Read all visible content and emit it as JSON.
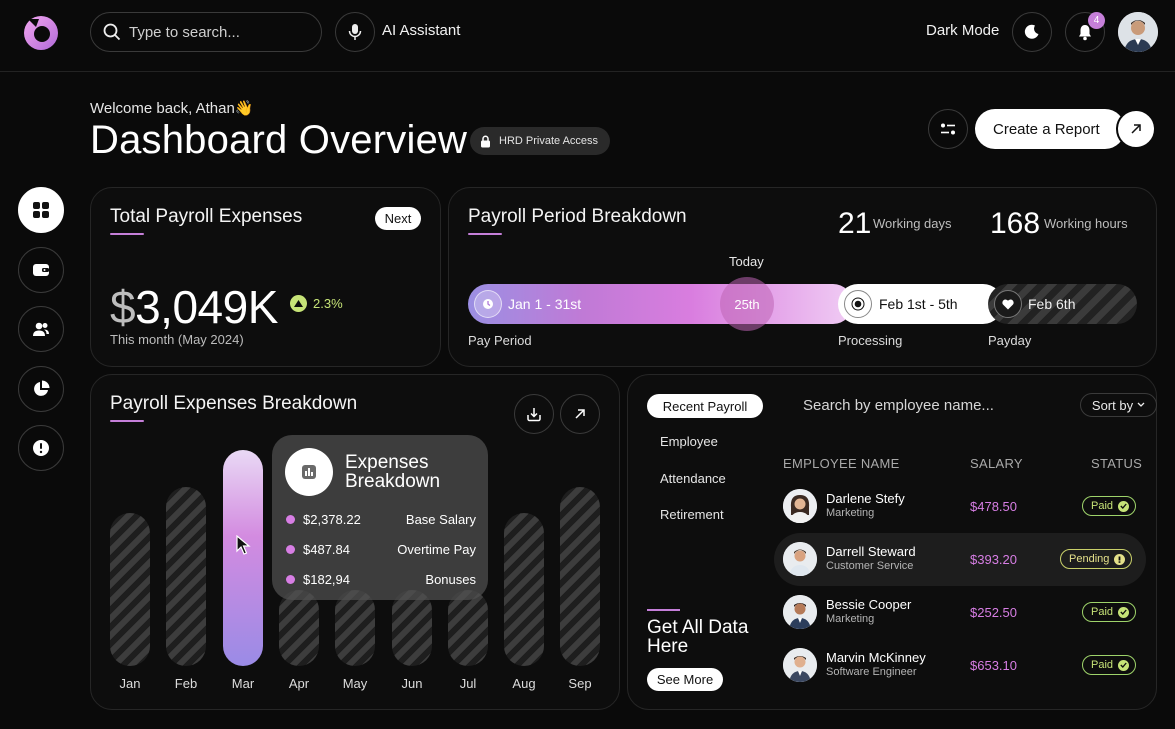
{
  "topbar": {
    "search_placeholder": "Type to search...",
    "ai_label": "AI Assistant",
    "dark_mode_label": "Dark Mode",
    "notification_count": "4"
  },
  "header": {
    "welcome": "Welcome back, Athan👋",
    "title": "Dashboard Overview",
    "access_badge": "HRD Private Access",
    "create_report": "Create a Report"
  },
  "sidebar": {
    "items": [
      {
        "icon": "grid-icon",
        "active": true
      },
      {
        "icon": "wallet-icon",
        "active": false
      },
      {
        "icon": "users-icon",
        "active": false
      },
      {
        "icon": "pie-chart-icon",
        "active": false
      },
      {
        "icon": "alert-icon",
        "active": false
      }
    ]
  },
  "total_payroll": {
    "title": "Total Payroll Expenses",
    "next_label": "Next",
    "currency": "$",
    "amount": "3,049K",
    "trend": "2.3%",
    "subtitle": "This month (May 2024)"
  },
  "period": {
    "title": "Payroll Period Breakdown",
    "working_days": "21",
    "working_days_label": "Working days",
    "working_hours": "168",
    "working_hours_label": "Working hours",
    "today_label": "Today",
    "today_value": "25th",
    "pay_period_range": "Jan 1 - 31st",
    "processing_range": "Feb 1st - 5th",
    "payday_date": "Feb 6th",
    "pay_period_label": "Pay Period",
    "processing_label": "Processing",
    "payday_label": "Payday"
  },
  "expenses_chart": {
    "title": "Payroll Expenses Breakdown",
    "months": [
      "Jan",
      "Feb",
      "Mar",
      "Apr",
      "May",
      "Jun",
      "Jul",
      "Aug",
      "Sep"
    ],
    "active_month": "Mar",
    "tooltip": {
      "title": "Expenses Breakdown",
      "rows": [
        {
          "value": "$2,378.22",
          "label": "Base Salary"
        },
        {
          "value": "$487.84",
          "label": "Overtime Pay"
        },
        {
          "value": "$182,94",
          "label": "Bonuses"
        }
      ]
    }
  },
  "recent": {
    "tabs": [
      "Recent Payroll",
      "Employee",
      "Attendance",
      "Retirement"
    ],
    "search_placeholder": "Search by employee name...",
    "sort_label": "Sort by",
    "columns": [
      "EMPLOYEE NAME",
      "SALARY",
      "STATUS"
    ],
    "rows": [
      {
        "name": "Darlene Stefy",
        "role": "Marketing",
        "salary": "$478.50",
        "status": "Paid"
      },
      {
        "name": "Darrell Steward",
        "role": "Customer Service",
        "salary": "$393.20",
        "status": "Pending"
      },
      {
        "name": "Bessie Cooper",
        "role": "Marketing",
        "salary": "$252.50",
        "status": "Paid"
      },
      {
        "name": "Marvin McKinney",
        "role": "Software Engineer",
        "salary": "$653.10",
        "status": "Paid"
      }
    ],
    "get_all": "Get All Data Here",
    "see_more": "See More"
  },
  "colors": {
    "accent": "#c57fd9",
    "positive": "#c6e377",
    "background": "#0a0a0a"
  }
}
